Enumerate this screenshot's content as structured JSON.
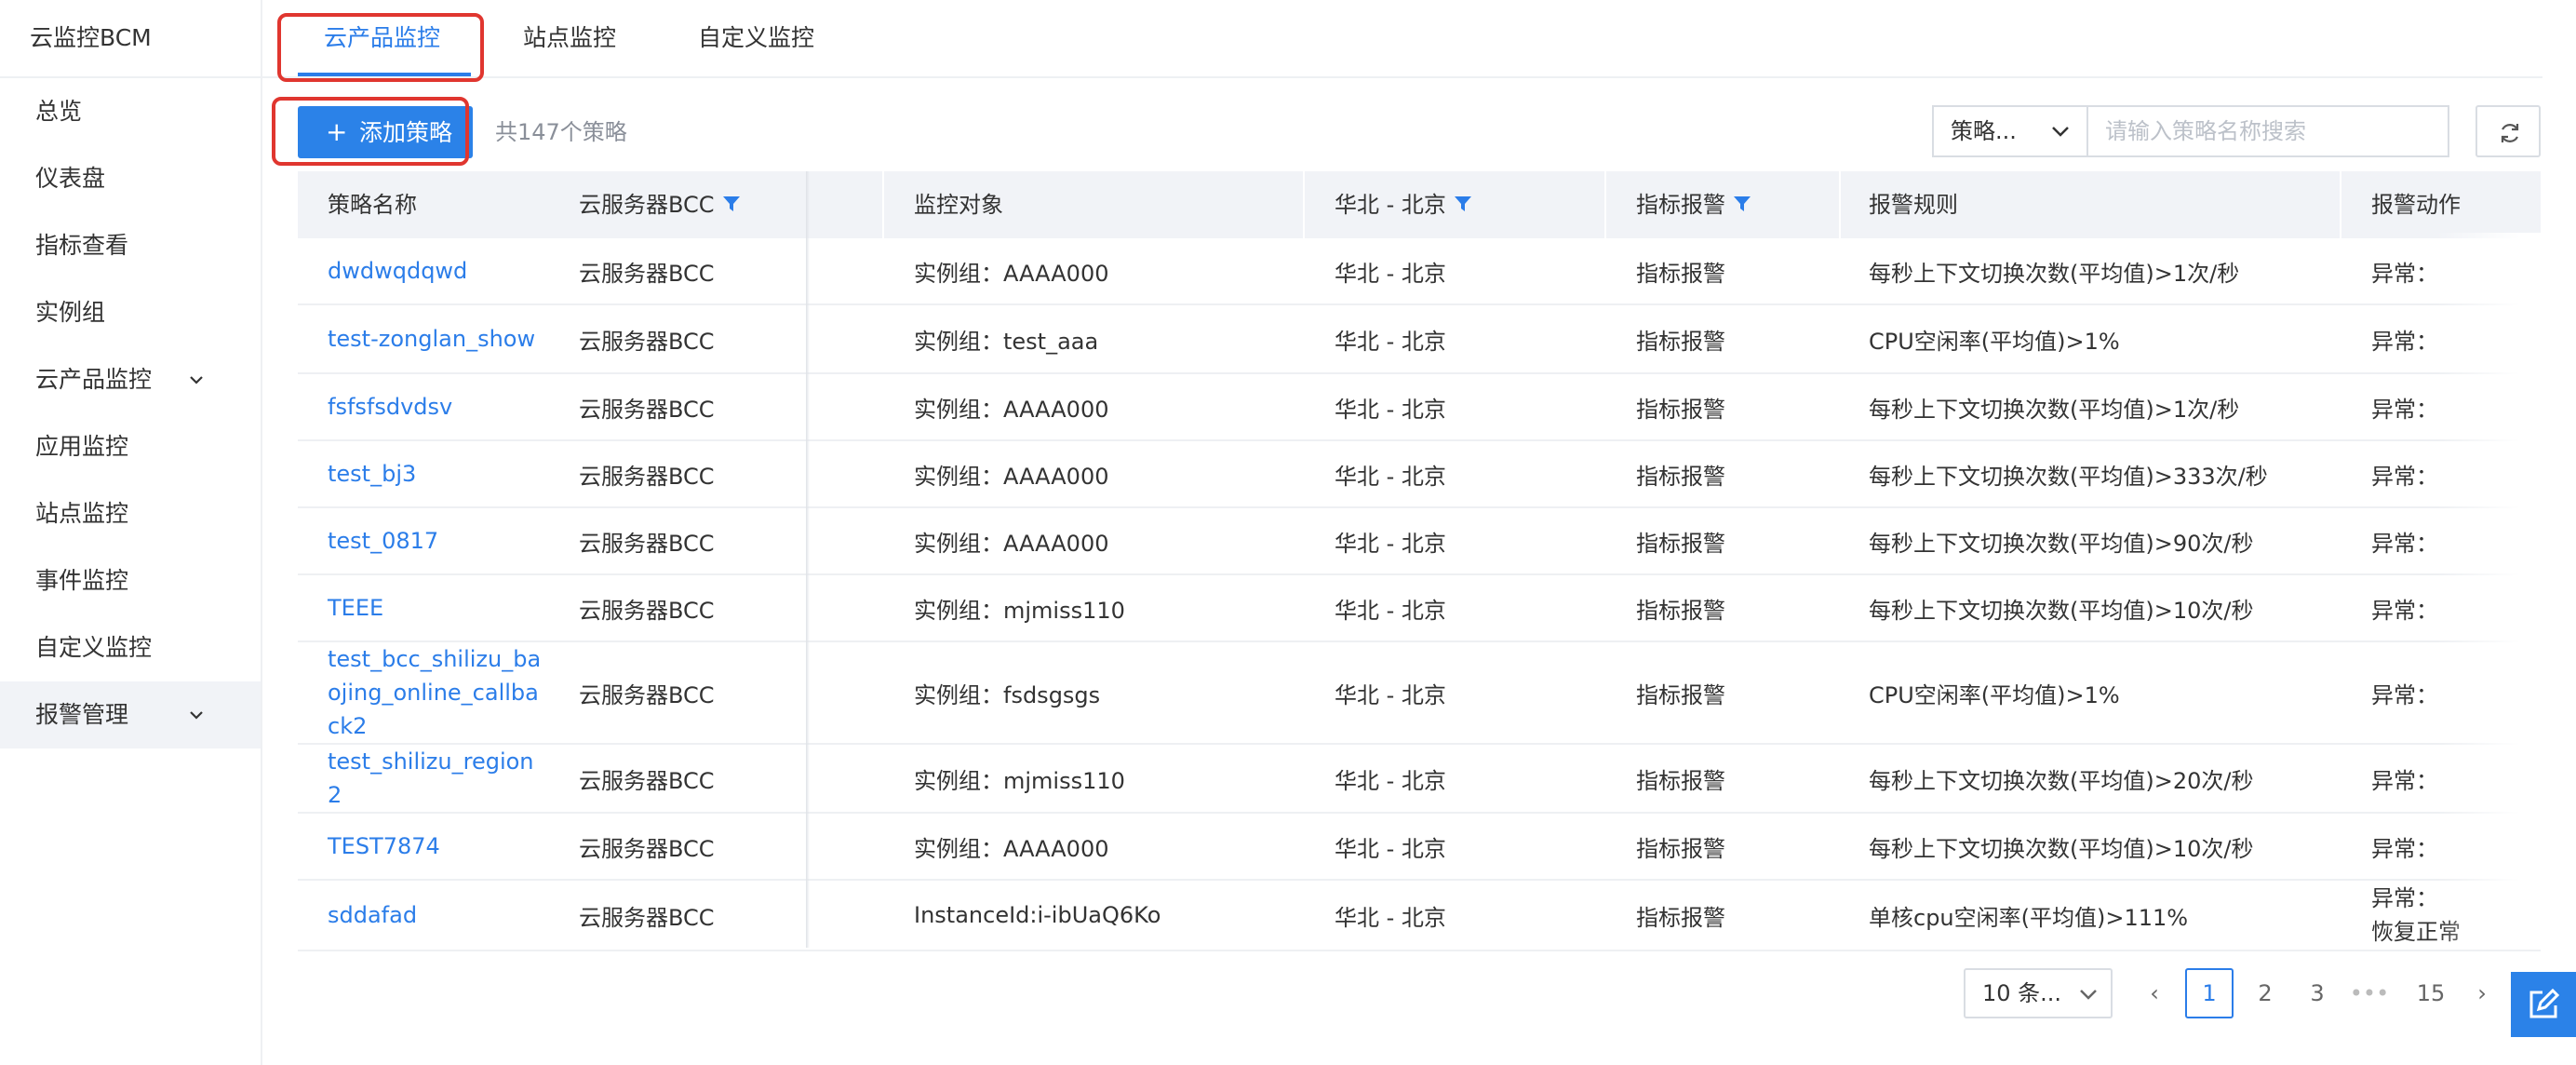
{
  "app": {
    "title": "云监控BCM"
  },
  "sidebar": {
    "items": [
      {
        "label": "总览",
        "has_chevron": false
      },
      {
        "label": "仪表盘",
        "has_chevron": false
      },
      {
        "label": "指标查看",
        "has_chevron": false
      },
      {
        "label": "实例组",
        "has_chevron": false
      },
      {
        "label": "云产品监控",
        "has_chevron": true
      },
      {
        "label": "应用监控",
        "has_chevron": false
      },
      {
        "label": "站点监控",
        "has_chevron": false
      },
      {
        "label": "事件监控",
        "has_chevron": false
      },
      {
        "label": "自定义监控",
        "has_chevron": false
      },
      {
        "label": "报警管理",
        "has_chevron": true,
        "active": true
      }
    ]
  },
  "tabs": [
    {
      "label": "云产品监控",
      "active": true
    },
    {
      "label": "站点监控",
      "active": false
    },
    {
      "label": "自定义监控",
      "active": false
    }
  ],
  "toolbar": {
    "add_label": "添加策略",
    "count_text": "共147个策略",
    "filter_select": "策略...",
    "search_placeholder": "请输入策略名称搜索"
  },
  "table": {
    "headers": [
      "策略名称",
      "云服务器BCC",
      "监控对象",
      "华北 - 北京",
      "指标报警",
      "报警规则",
      "报警动作"
    ],
    "rows": [
      {
        "name": "dwdwqdqwd",
        "product": "云服务器BCC",
        "target": "实例组：AAAA000",
        "region": "华北 - 北京",
        "type": "指标报警",
        "rule": "每秒上下文切换次数(平均值)>1次/秒",
        "action": "异常："
      },
      {
        "name": "test-zonglan_show",
        "product": "云服务器BCC",
        "target": "实例组：test_aaa",
        "region": "华北 - 北京",
        "type": "指标报警",
        "rule": "CPU空闲率(平均值)>1%",
        "action": "异常："
      },
      {
        "name": "fsfsfsdvdsv",
        "product": "云服务器BCC",
        "target": "实例组：AAAA000",
        "region": "华北 - 北京",
        "type": "指标报警",
        "rule": "每秒上下文切换次数(平均值)>1次/秒",
        "action": "异常："
      },
      {
        "name": "test_bj3",
        "product": "云服务器BCC",
        "target": "实例组：AAAA000",
        "region": "华北 - 北京",
        "type": "指标报警",
        "rule": "每秒上下文切换次数(平均值)>333次/秒",
        "action": "异常："
      },
      {
        "name": "test_0817",
        "product": "云服务器BCC",
        "target": "实例组：AAAA000",
        "region": "华北 - 北京",
        "type": "指标报警",
        "rule": "每秒上下文切换次数(平均值)>90次/秒",
        "action": "异常："
      },
      {
        "name": "TEEE",
        "product": "云服务器BCC",
        "target": "实例组：mjmiss110",
        "region": "华北 - 北京",
        "type": "指标报警",
        "rule": "每秒上下文切换次数(平均值)>10次/秒",
        "action": "异常："
      },
      {
        "name": "test_bcc_shilizu_baojing_online_callback2",
        "product": "云服务器BCC",
        "target": "实例组：fsdsgsgs",
        "region": "华北 - 北京",
        "type": "指标报警",
        "rule": "CPU空闲率(平均值)>1%",
        "action": "异常："
      },
      {
        "name": "test_shilizu_region2",
        "product": "云服务器BCC",
        "target": "实例组：mjmiss110",
        "region": "华北 - 北京",
        "type": "指标报警",
        "rule": "每秒上下文切换次数(平均值)>20次/秒",
        "action": "异常："
      },
      {
        "name": "TEST7874",
        "product": "云服务器BCC",
        "target": "实例组：AAAA000",
        "region": "华北 - 北京",
        "type": "指标报警",
        "rule": "每秒上下文切换次数(平均值)>10次/秒",
        "action": "异常："
      },
      {
        "name": "sddafad",
        "product": "云服务器BCC",
        "target": "InstanceId:i-ibUaQ6Ko",
        "region": "华北 - 北京",
        "type": "指标报警",
        "rule": "单核cpu空闲率(平均值)>111%",
        "action": "异常：",
        "action2": "恢复正常"
      }
    ]
  },
  "pagination": {
    "page_size": "10 条...",
    "pages": [
      "1",
      "2",
      "3",
      "•••",
      "15"
    ],
    "current": "1",
    "prev": "‹",
    "next": "›"
  },
  "colors": {
    "accent": "#2b82e8",
    "link": "#2b7de9",
    "highlight_box": "#e0362f"
  }
}
